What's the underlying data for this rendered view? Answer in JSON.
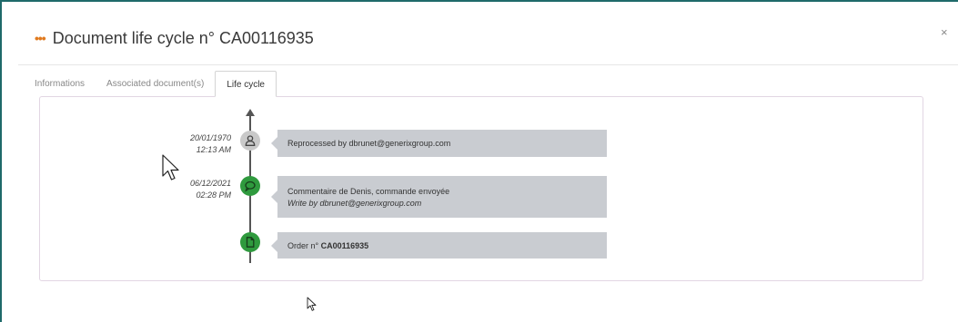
{
  "modal": {
    "title": "Document life cycle n° CA00116935",
    "close_label": "×"
  },
  "tabs": [
    {
      "label": "Informations",
      "active": false
    },
    {
      "label": "Associated document(s)",
      "active": false
    },
    {
      "label": "Life cycle",
      "active": true
    }
  ],
  "timeline": {
    "events": [
      {
        "date": "20/01/1970",
        "time": "12:13 AM",
        "icon": "user-icon",
        "text": "Reprocessed by dbrunet@generixgroup.com",
        "sub": ""
      },
      {
        "date": "06/12/2021",
        "time": "02:28 PM",
        "icon": "comment-icon",
        "text": "Commentaire de Denis, commande envoyée",
        "sub": "Write by dbrunet@generixgroup.com"
      },
      {
        "date": "",
        "time": "",
        "icon": "document-icon",
        "text_prefix": "Order n° ",
        "text_strong": "CA00116935",
        "sub": ""
      }
    ]
  },
  "colors": {
    "accent": "#e07a1f",
    "frame": "#1f6a6a",
    "node_green": "#2f9a3e",
    "node_grey": "#c9c9c9",
    "card_bg": "#c9ccd1"
  }
}
